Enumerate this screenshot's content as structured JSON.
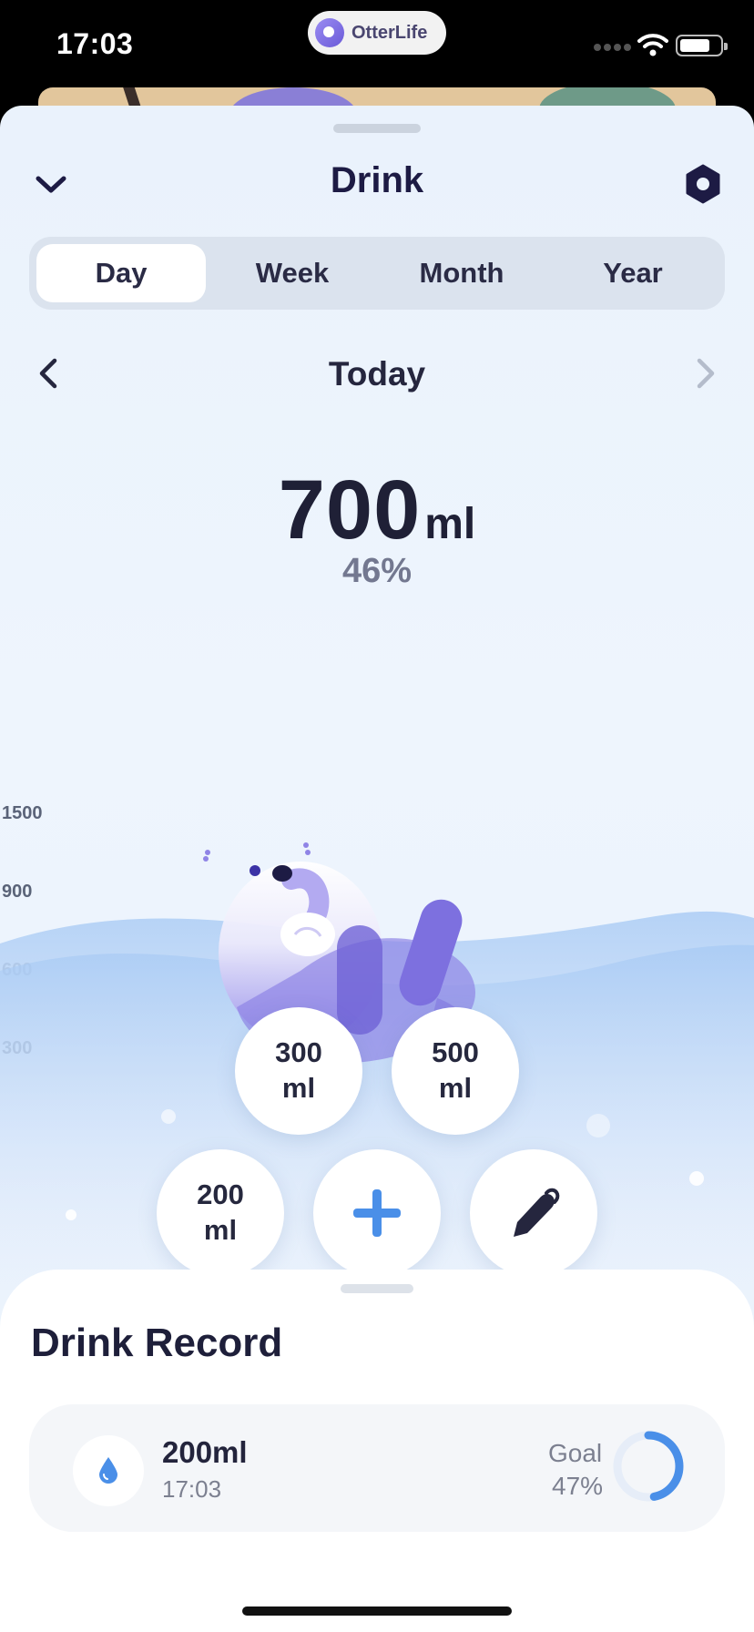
{
  "status_bar": {
    "time": "17:03",
    "app_name": "OtterLife"
  },
  "header": {
    "title": "Drink",
    "back_icon": "chevron-down-icon",
    "settings_icon": "hexagon-settings-icon"
  },
  "tabs": [
    {
      "label": "Day",
      "active": true
    },
    {
      "label": "Week",
      "active": false
    },
    {
      "label": "Month",
      "active": false
    },
    {
      "label": "Year",
      "active": false
    }
  ],
  "date_nav": {
    "label": "Today",
    "prev_icon": "chevron-left-icon",
    "next_icon": "chevron-right-icon"
  },
  "summary": {
    "amount": "700",
    "unit": "ml",
    "percent": "46%"
  },
  "y_axis_labels": [
    "1500",
    "900",
    "600",
    "300"
  ],
  "quick_add": [
    {
      "line1": "300",
      "line2": "ml"
    },
    {
      "line1": "500",
      "line2": "ml"
    },
    {
      "line1": "200",
      "line2": "ml"
    }
  ],
  "actions": {
    "add_icon": "plus-icon",
    "edit_icon": "pen-icon"
  },
  "record": {
    "title": "Drink Record",
    "entries": [
      {
        "amount": "200ml",
        "time": "17:03",
        "goal_label": "Goal",
        "goal_percent": "47%",
        "goal_progress": 0.47
      }
    ]
  },
  "colors": {
    "accent_blue": "#4a8fe8",
    "title_navy": "#1d1b44",
    "otter_purple": "#7f73e0"
  }
}
